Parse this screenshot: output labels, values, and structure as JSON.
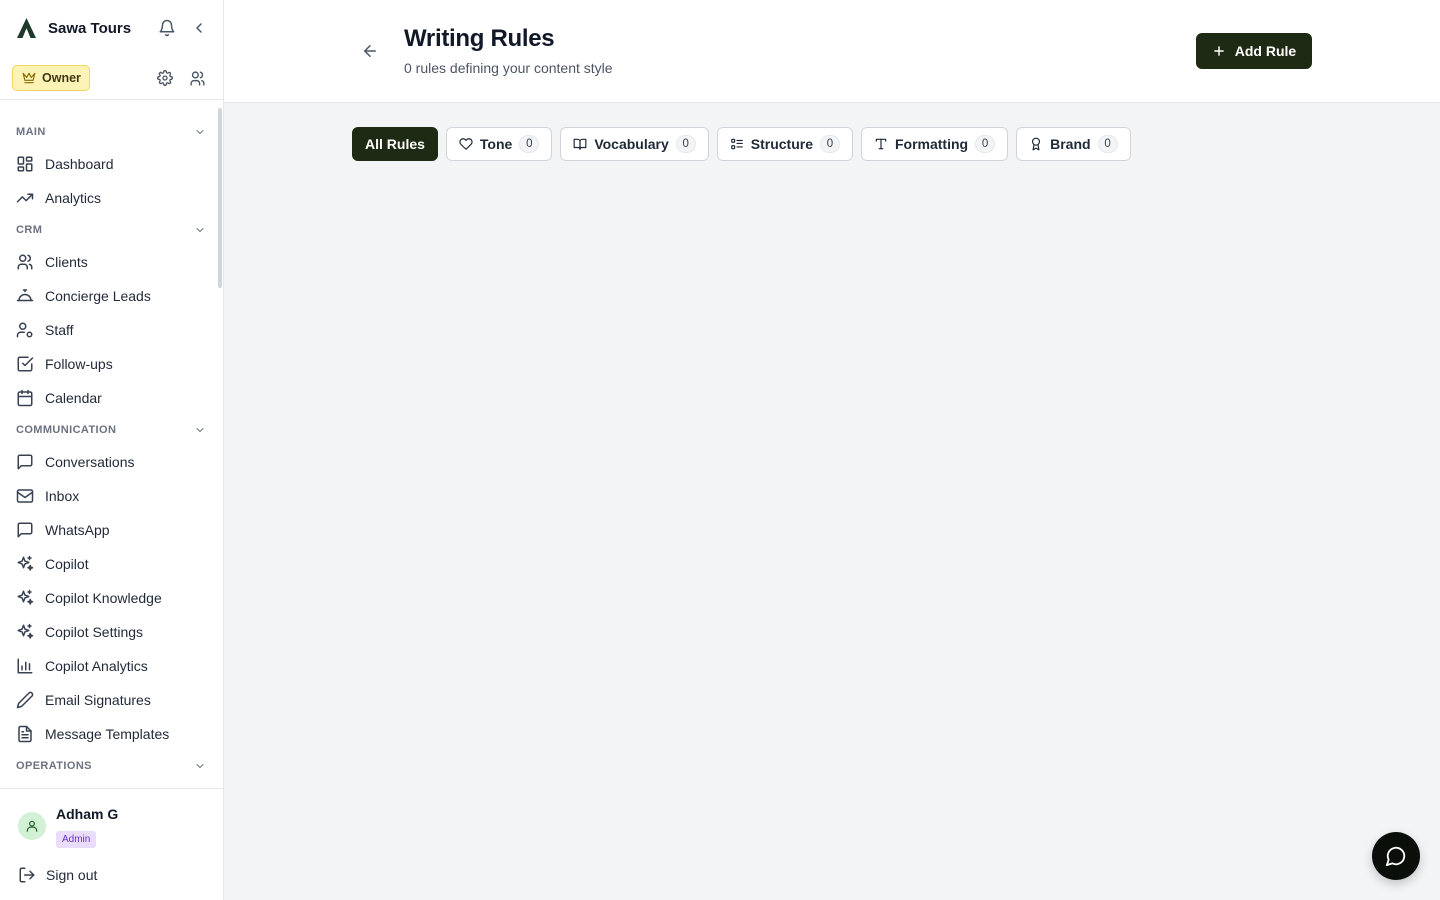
{
  "brand": {
    "name": "Sawa Tours"
  },
  "role": {
    "badge": "Owner"
  },
  "nav": {
    "sections": {
      "main": "MAIN",
      "crm": "CRM",
      "communication": "COMMUNICATION",
      "operations": "OPERATIONS"
    },
    "items": {
      "dashboard": "Dashboard",
      "analytics": "Analytics",
      "clients": "Clients",
      "concierge_leads": "Concierge Leads",
      "staff": "Staff",
      "follow_ups": "Follow-ups",
      "calendar": "Calendar",
      "conversations": "Conversations",
      "inbox": "Inbox",
      "whatsapp": "WhatsApp",
      "copilot": "Copilot",
      "copilot_knowledge": "Copilot Knowledge",
      "copilot_settings": "Copilot Settings",
      "copilot_analytics": "Copilot Analytics",
      "email_signatures": "Email Signatures",
      "message_templates": "Message Templates"
    }
  },
  "user": {
    "name": "Adham G",
    "role": "Admin",
    "sign_out": "Sign out"
  },
  "header": {
    "title": "Writing Rules",
    "subtitle": "0 rules defining your content style",
    "add_button": "Add Rule"
  },
  "tabs": {
    "all": {
      "label": "All Rules"
    },
    "tone": {
      "label": "Tone",
      "count": "0"
    },
    "vocabulary": {
      "label": "Vocabulary",
      "count": "0"
    },
    "structure": {
      "label": "Structure",
      "count": "0"
    },
    "formatting": {
      "label": "Formatting",
      "count": "0"
    },
    "brand": {
      "label": "Brand",
      "count": "0"
    }
  },
  "colors": {
    "accent": "#1f2a14",
    "owner_badge_bg": "#fdf3b7",
    "admin_badge_bg": "#e9ddfb"
  },
  "icons": [
    "logo-icon",
    "bell-icon",
    "collapse-icon",
    "settings-icon",
    "users-icon",
    "crown-icon",
    "chevron-down-icon",
    "back-arrow-icon",
    "plus-icon",
    "heart-icon",
    "book-icon",
    "list-icon",
    "text-icon",
    "award-icon",
    "chat-icon",
    "sign-out-icon"
  ]
}
